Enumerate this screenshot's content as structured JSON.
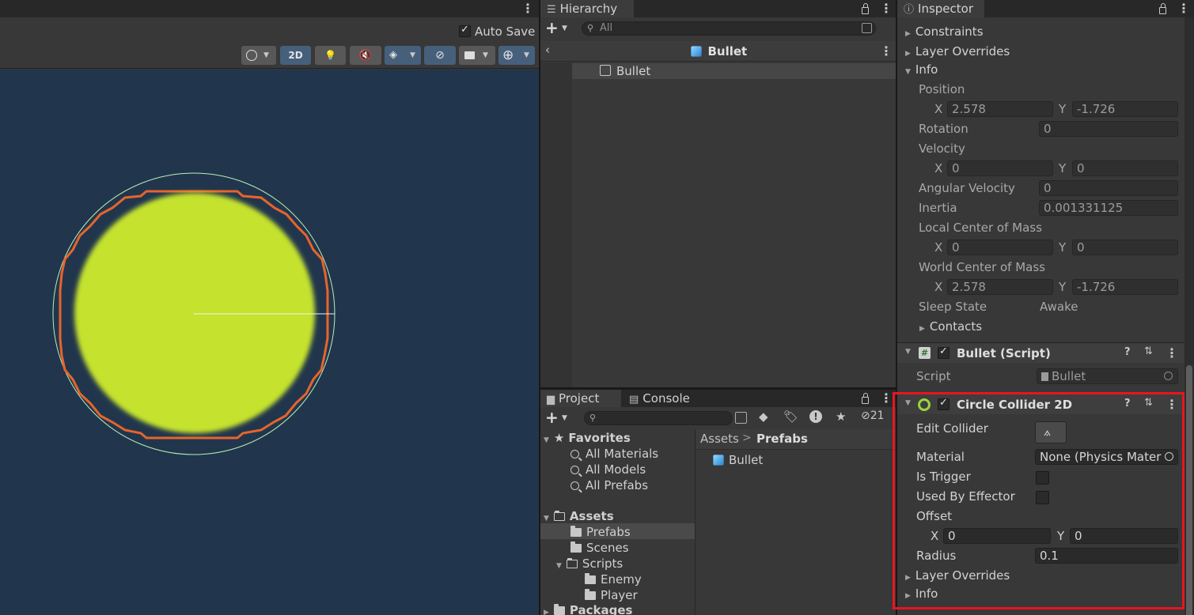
{
  "scene": {
    "auto_save_label": "Auto Save",
    "auto_save_checked": true,
    "toolbar": {
      "mode_2d_label": "2D"
    },
    "colors": {
      "background": "#21364d",
      "sprite": "#c5e22d",
      "collider_outline": "#e8642a",
      "gizmo_circle": "#b8f0b8"
    }
  },
  "hierarchy": {
    "tab_label": "Hierarchy",
    "search_placeholder": "All",
    "prefab_title": "Bullet",
    "items": [
      {
        "label": "Bullet"
      }
    ]
  },
  "project": {
    "tabs": [
      {
        "label": "Project"
      },
      {
        "label": "Console"
      }
    ],
    "hidden_count": "21",
    "breadcrumb": {
      "root": "Assets",
      "separator": ">",
      "current": "Prefabs"
    },
    "favorites": {
      "label": "Favorites",
      "items": [
        "All Materials",
        "All Models",
        "All Prefabs"
      ]
    },
    "assets": {
      "label": "Assets",
      "folders": [
        "Prefabs",
        "Scenes",
        "Scripts",
        "Enemy",
        "Player"
      ]
    },
    "packages_label": "Packages",
    "files": [
      {
        "label": "Bullet"
      }
    ]
  },
  "inspector": {
    "tab_label": "Inspector",
    "rigidbody": {
      "constraints_label": "Constraints",
      "layer_overrides_label": "Layer Overrides",
      "info_label": "Info",
      "position_label": "Position",
      "position_x": "2.578",
      "position_y": "-1.726",
      "rotation_label": "Rotation",
      "rotation_value": "0",
      "velocity_label": "Velocity",
      "velocity_x": "0",
      "velocity_y": "0",
      "angular_velocity_label": "Angular Velocity",
      "angular_velocity_value": "0",
      "inertia_label": "Inertia",
      "inertia_value": "0.001331125",
      "local_com_label": "Local Center of Mass",
      "local_com_x": "0",
      "local_com_y": "0",
      "world_com_label": "World Center of Mass",
      "world_com_x": "2.578",
      "world_com_y": "-1.726",
      "sleep_state_label": "Sleep State",
      "sleep_state_value": "Awake",
      "contacts_label": "Contacts"
    },
    "script_component": {
      "title": "Bullet (Script)",
      "script_label": "Script",
      "script_value": "Bullet"
    },
    "circle_collider": {
      "title": "Circle Collider 2D",
      "edit_collider_label": "Edit Collider",
      "material_label": "Material",
      "material_value": "None (Physics Materi",
      "is_trigger_label": "Is Trigger",
      "used_by_effector_label": "Used By Effector",
      "offset_label": "Offset",
      "offset_x": "0",
      "offset_y": "0",
      "radius_label": "Radius",
      "radius_value": "0.1",
      "layer_overrides_label": "Layer Overrides",
      "info_label": "Info"
    },
    "axis_x": "X",
    "axis_y": "Y",
    "highlight_color": "#e8151f"
  }
}
